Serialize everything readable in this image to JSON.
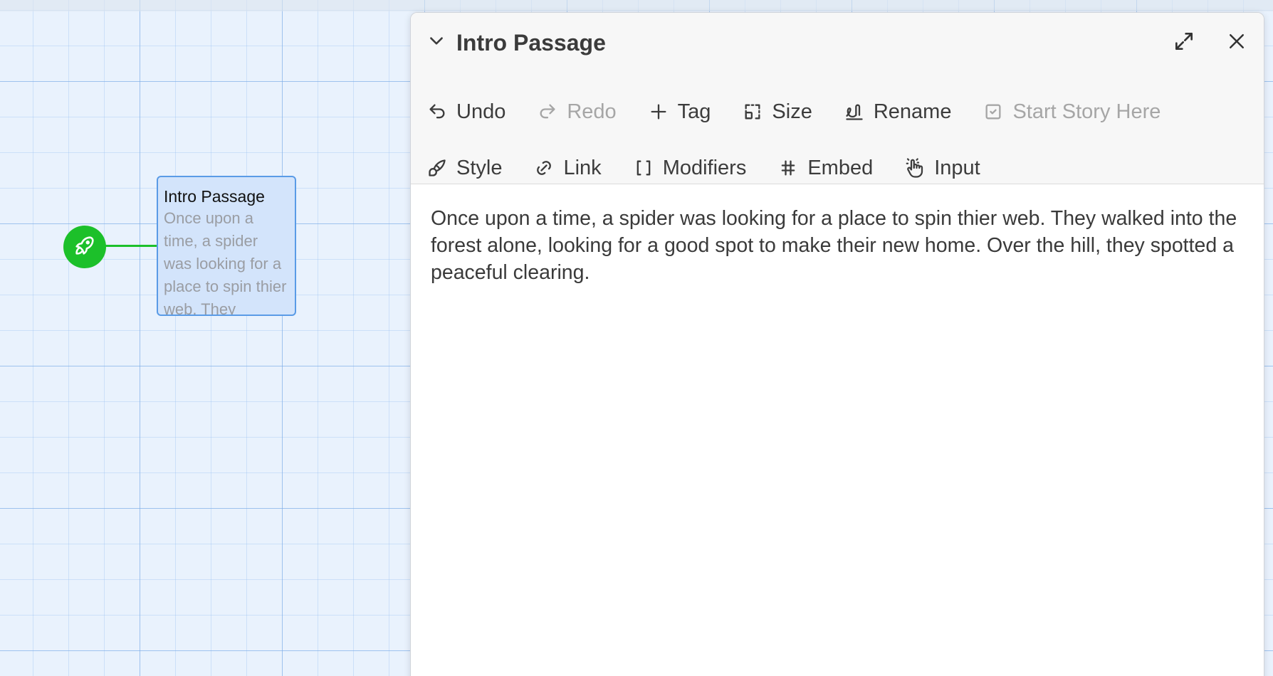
{
  "story_map": {
    "passage_card": {
      "title": "Intro Passage",
      "excerpt": "Once upon a time, a spider was looking for a place to spin thier web. They"
    },
    "start_icon": "rocket-icon",
    "colors": {
      "start_node": "#1cc02a",
      "card_background": "#d3e4fb",
      "card_border": "#5a9be6",
      "grid_background": "#e9f2fd"
    }
  },
  "dialog": {
    "title": "Intro Passage",
    "collapse_icon": "chevron-down-icon",
    "maximize_icon": "expand-icon",
    "close_icon": "close-icon",
    "toolbar_row1": [
      {
        "label": "Undo",
        "icon": "undo-icon",
        "disabled": false
      },
      {
        "label": "Redo",
        "icon": "redo-icon",
        "disabled": true
      },
      {
        "label": "Tag",
        "icon": "plus-icon",
        "disabled": false
      },
      {
        "label": "Size",
        "icon": "resize-icon",
        "disabled": false
      },
      {
        "label": "Rename",
        "icon": "signature-icon",
        "disabled": false
      },
      {
        "label": "Start Story Here",
        "icon": "checkbox-icon",
        "disabled": true
      }
    ],
    "toolbar_row2": [
      {
        "label": "Style",
        "icon": "brush-icon",
        "disabled": false
      },
      {
        "label": "Link",
        "icon": "link-icon",
        "disabled": false
      },
      {
        "label": "Modifiers",
        "icon": "brackets-icon",
        "disabled": false
      },
      {
        "label": "Embed",
        "icon": "hash-icon",
        "disabled": false
      },
      {
        "label": "Input",
        "icon": "hand-click-icon",
        "disabled": false
      }
    ],
    "passage_text": "Once upon a time, a spider was looking for a place to spin thier web. They walked into the forest alone, looking for a good spot to make their new home. Over the hill, they spotted a peaceful clearing."
  }
}
